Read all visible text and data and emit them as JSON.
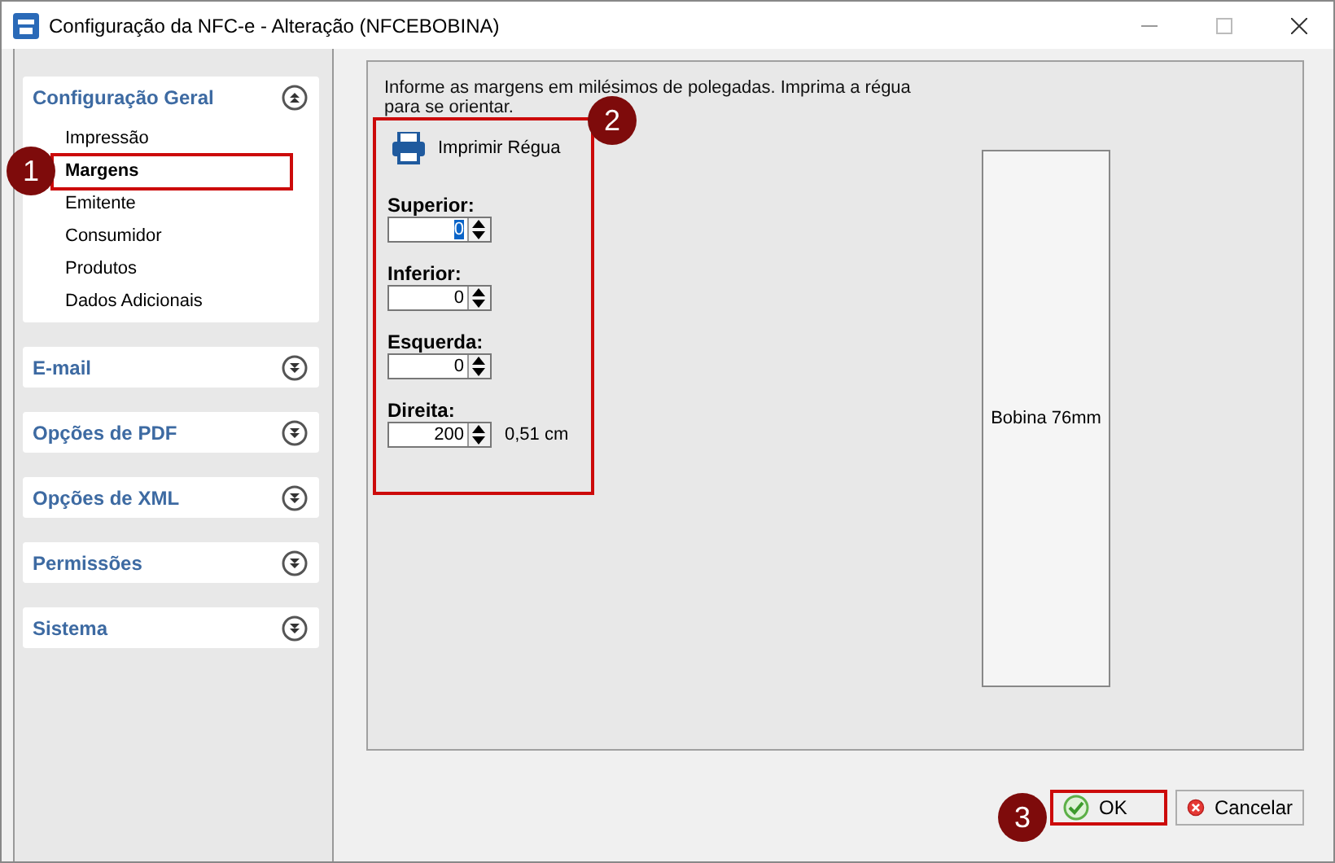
{
  "window": {
    "title": "Configuração da NFC-e - Alteração  (NFCEBOBINA)"
  },
  "sidebar": {
    "groups": [
      {
        "title": "Configuração Geral",
        "expanded": true,
        "items": [
          {
            "label": "Impressão",
            "selected": false
          },
          {
            "label": "Margens",
            "selected": true,
            "annotation": "1"
          },
          {
            "label": "Emitente",
            "selected": false
          },
          {
            "label": "Consumidor",
            "selected": false
          },
          {
            "label": "Produtos",
            "selected": false
          },
          {
            "label": "Dados Adicionais",
            "selected": false
          }
        ]
      },
      {
        "title": "E-mail",
        "expanded": false
      },
      {
        "title": "Opções de PDF",
        "expanded": false
      },
      {
        "title": "Opções de XML",
        "expanded": false
      },
      {
        "title": "Permissões",
        "expanded": false
      },
      {
        "title": "Sistema",
        "expanded": false
      }
    ]
  },
  "content": {
    "instruction": "Informe as margens em milésimos de polegadas. Imprima a régua para se orientar.",
    "annotation": "2",
    "print_button": "Imprimir Régua",
    "fields": [
      {
        "label": "Superior:",
        "value": "0",
        "focused": true
      },
      {
        "label": "Inferior:",
        "value": "0",
        "focused": false
      },
      {
        "label": "Esquerda:",
        "value": "0",
        "focused": false
      },
      {
        "label": "Direita:",
        "value": "200",
        "focused": false,
        "note": "0,51 cm"
      }
    ],
    "preview": {
      "label": "Bobina 76mm"
    }
  },
  "buttons": [
    {
      "kind": "ok",
      "label": "OK",
      "annotation": "3"
    },
    {
      "kind": "cancel",
      "label": "Cancelar"
    }
  ]
}
